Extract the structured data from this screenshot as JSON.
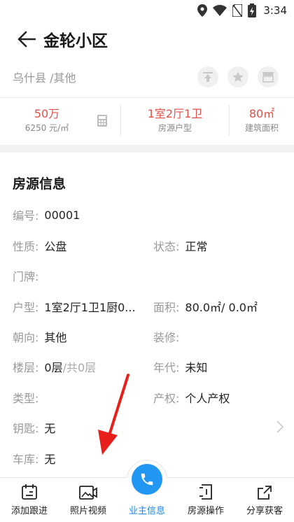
{
  "status_bar": {
    "time": "3:34"
  },
  "header": {
    "title": "金轮小区"
  },
  "location": {
    "text": "乌什县 /其他"
  },
  "summary": {
    "price": "50万",
    "unit_price": "6250 元/㎡",
    "layout_value": "1室2厅1卫",
    "layout_label": "房源户型",
    "area_value": "80㎡",
    "area_label": "建筑面积"
  },
  "section": {
    "title": "房源信息",
    "fields": {
      "code_label": "编号:",
      "code_value": "00001",
      "nature_label": "性质:",
      "nature_value": "公盘",
      "status_label": "状态:",
      "status_value": "正常",
      "doorplate_label": "门牌:",
      "layout_label": "户型:",
      "layout_value": "1室2厅1卫1厨0...",
      "area_label": "面积:",
      "area_value": "80.0㎡/ 0.0㎡",
      "orientation_label": "朝向:",
      "orientation_value": "其他",
      "decoration_label": "装修:",
      "floor_label": "楼层:",
      "floor_value": "0层",
      "floor_total": "/共0层",
      "year_label": "年代:",
      "year_value": "未知",
      "type_label": "类型:",
      "property_label": "产权:",
      "property_value": "个人产权",
      "key_label": "钥匙:",
      "key_value": "无",
      "garage_label": "车库:",
      "garage_value": "无"
    }
  },
  "bottom_nav": {
    "items": [
      {
        "label": "添加跟进",
        "icon": "calendar-icon"
      },
      {
        "label": "照片视频",
        "icon": "photo-video-icon"
      },
      {
        "label": "业主信息",
        "icon": "phone-icon"
      },
      {
        "label": "房源操作",
        "icon": "operation-icon"
      },
      {
        "label": "分享获客",
        "icon": "share-icon"
      }
    ],
    "active_index": 2
  },
  "colors": {
    "accent_blue": "#2196f3",
    "price_red": "#e0504a",
    "annotation_red": "#e8201c"
  }
}
